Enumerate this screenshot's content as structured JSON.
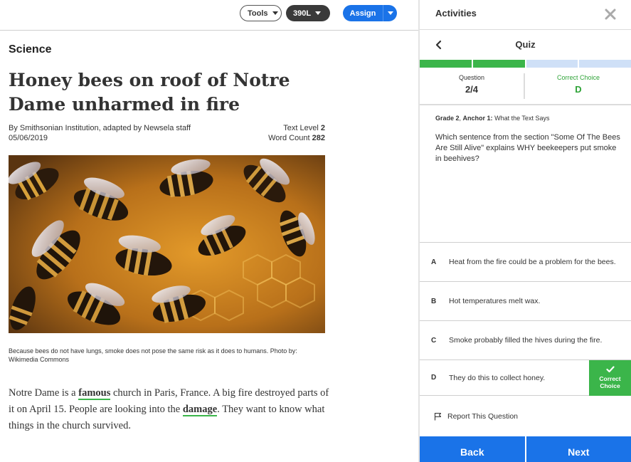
{
  "toolbar": {
    "tools_label": "Tools",
    "level_label": "390L",
    "assign_label": "Assign"
  },
  "article": {
    "subject": "Science",
    "headline": "Honey bees on roof of Notre Dame unharmed in fire",
    "byline": "By Smithsonian Institution, adapted by Newsela staff",
    "date": "05/06/2019",
    "text_level_label": "Text Level",
    "text_level_value": "2",
    "word_count_label": "Word Count",
    "word_count_value": "282",
    "photo_caption": "Because bees do not have lungs, smoke does not pose the same risk as it does to humans. Photo by: Wikimedia Commons",
    "body": {
      "p1_a": "Notre Dame is a ",
      "vocab1": "famous",
      "p1_b": " church in Paris, France. A big fire destroyed parts of it on April 15. People are looking into the ",
      "vocab2": "damage",
      "p1_c": ". They want to know what things in the church survived."
    }
  },
  "activities": {
    "title": "Activities",
    "quiz_title": "Quiz",
    "progress": {
      "current": 2,
      "total": 4
    },
    "question_label": "Question",
    "question_value": "2/4",
    "correct_label": "Correct Choice",
    "correct_value": "D",
    "meta_grade": "Grade 2",
    "meta_anchor": "Anchor 1:",
    "meta_anchor_text": "What the Text Says",
    "question_text": "Which sentence from the section \"Some Of The Bees Are Still Alive\" explains WHY beekeepers put smoke in beehives?",
    "answers": [
      {
        "letter": "A",
        "text": "Heat from the fire could be a problem for the bees."
      },
      {
        "letter": "B",
        "text": "Hot temperatures melt wax."
      },
      {
        "letter": "C",
        "text": "Smoke probably filled the hives during the fire."
      },
      {
        "letter": "D",
        "text": "They do this to collect honey."
      }
    ],
    "correct_badge_line1": "Correct",
    "correct_badge_line2": "Choice",
    "report_label": "Report This Question",
    "back_label": "Back",
    "next_label": "Next"
  },
  "colors": {
    "accent_blue": "#1a73e8",
    "correct_green": "#3bb54a",
    "progress_pending": "#cfe0f7"
  }
}
